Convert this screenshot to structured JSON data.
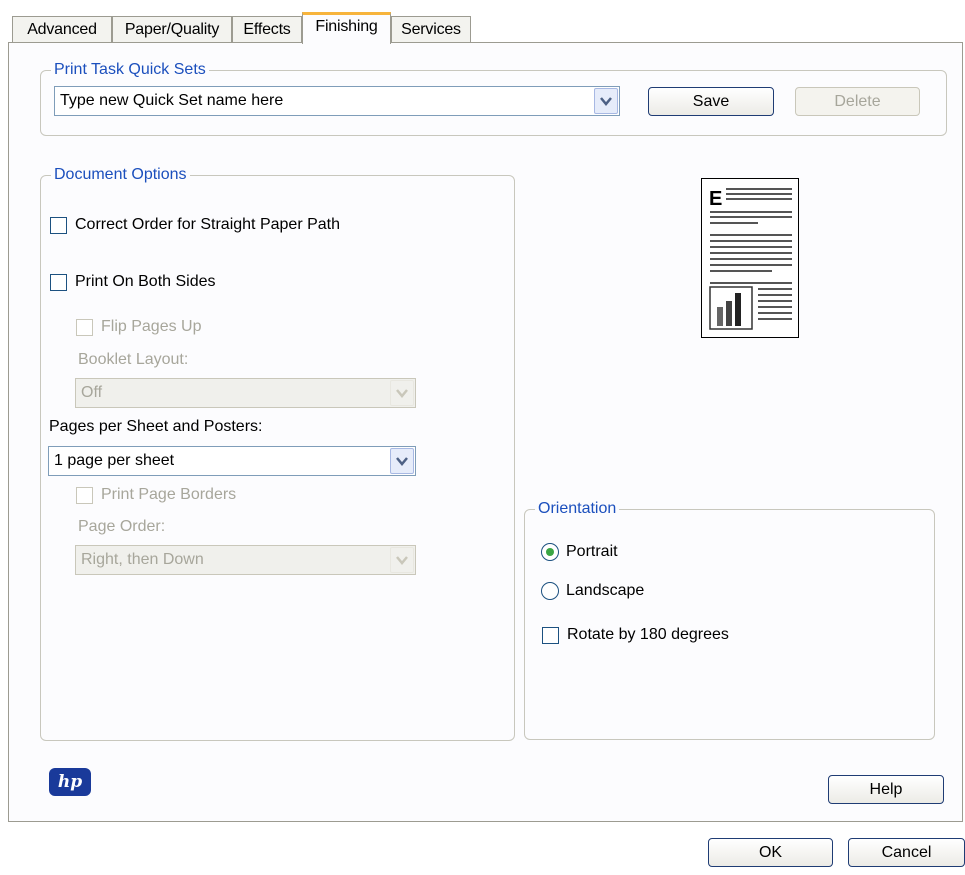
{
  "tabs": [
    {
      "label": "Advanced",
      "active": false
    },
    {
      "label": "Paper/Quality",
      "active": false
    },
    {
      "label": "Effects",
      "active": false
    },
    {
      "label": "Finishing",
      "active": true
    },
    {
      "label": "Services",
      "active": false
    }
  ],
  "quick_sets": {
    "legend": "Print Task Quick Sets",
    "value": "Type new Quick Set name here",
    "save_label": "Save",
    "delete_label": "Delete"
  },
  "document_options": {
    "legend": "Document Options",
    "correct_order_label": "Correct Order for Straight Paper Path",
    "correct_order_checked": false,
    "both_sides_label": "Print On Both Sides",
    "both_sides_checked": false,
    "flip_pages_label": "Flip Pages Up",
    "booklet_label": "Booklet Layout:",
    "booklet_value": "Off",
    "pages_per_sheet_label": "Pages per Sheet and Posters:",
    "pages_per_sheet_value": "1 page per sheet",
    "page_borders_label": "Print Page Borders",
    "page_order_label": "Page Order:",
    "page_order_value": "Right, then Down"
  },
  "preview": {
    "letter": "E"
  },
  "orientation": {
    "legend": "Orientation",
    "portrait_label": "Portrait",
    "landscape_label": "Landscape",
    "selected": "Portrait",
    "rotate_label": "Rotate by 180 degrees",
    "rotate_checked": false
  },
  "logo": {
    "text": "hp"
  },
  "buttons": {
    "help": "Help",
    "ok": "OK",
    "cancel": "Cancel"
  },
  "colors": {
    "legend_text": "#1b4fbd",
    "active_tab_accent": "#f7b43c",
    "disabled_text": "#a7a69b"
  }
}
